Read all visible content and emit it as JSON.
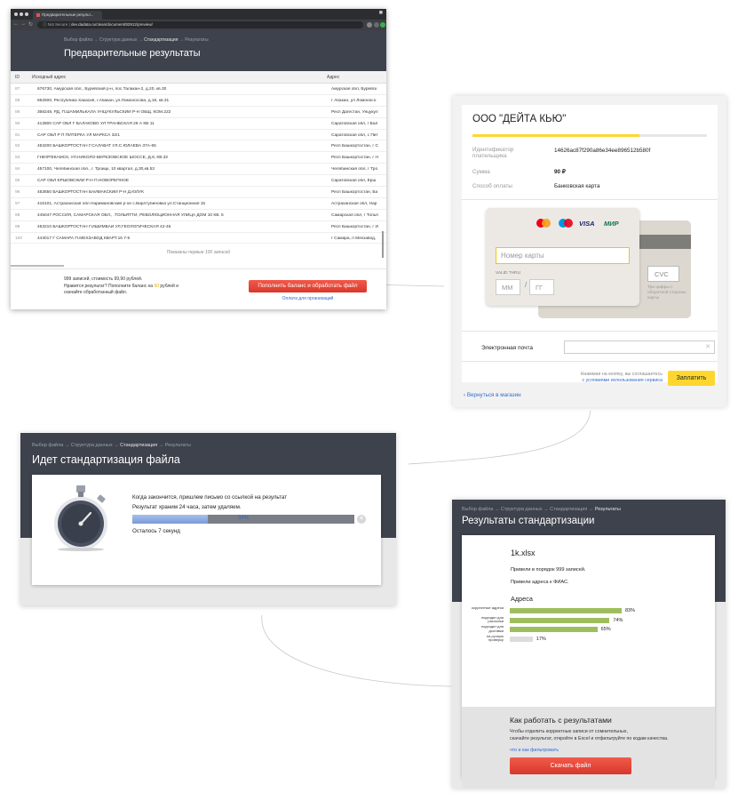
{
  "browser": {
    "tab_title": "Предварительные результ...",
    "url_secure": "Not Secure",
    "url_text": "dev.dadata.ru/clean/document/82912/preview/",
    "breadcrumbs": [
      "Выбор файла",
      "Структура данных",
      "Стандартизация",
      "Результаты"
    ],
    "breadcrumb_current": "Стандартизация",
    "title": "Предварительные результаты",
    "columns": {
      "id": "ID",
      "source": "Исходный адрес",
      "address": "Адрес"
    },
    "rows": [
      {
        "id": "87",
        "source": "676730, Амурская обл., Бурейский р-н, пос.Талакан-2, д.20, кв.30",
        "address": "Амурская обл, Бурейск"
      },
      {
        "id": "88",
        "source": "662600, Республика Хакасия, г.Абакан, ул.Ломоносова, д.16, кв.31",
        "address": "г Абакан, ул Ломоносо"
      },
      {
        "id": "89",
        "source": "368248, РД, П.ШАМИЛЬКАЛА УНЦУКУЛЬСКИЙ Р-Н ОБЩ. КОМ.222",
        "address": "Респ Дагестан, Унцукул"
      },
      {
        "id": "90",
        "source": "413800 САР ОБЛ Г БАЛАКОВО УЛ ТРАНБСКАЯ 28 А КВ 11",
        "address": "Саратовская обл, г Бал"
      },
      {
        "id": "91",
        "source": "САР ОБЛ Р П ПИТЕРКА УЛ МАРКСА 32/1",
        "address": "Саратовская обл, с Пит"
      },
      {
        "id": "92",
        "source": "453200 БАШКОРТОСТАН Г.САЛАВАТ УЛ.С.ЮЛАЕВА 37А-65",
        "address": "Респ Башкортостан, г С"
      },
      {
        "id": "93",
        "source": "ГНЕФТЕКАМСК, УЛ.НИКОЛО-БЕРЕЗОВСКОЕ ШОССЕ, Д.8, КВ.32",
        "address": "Респ Башкортостан, г Н"
      },
      {
        "id": "94",
        "source": "457100, Челябинская обл., г. Троицк, 10 квартал, д.30,кв.53",
        "address": "Челябинская обл, г Тро"
      },
      {
        "id": "95",
        "source": "САР ОБЛ ЕРШОВСКИЙ Р-Н П.НОВОРЕПНОЕ",
        "address": "Саратовская обл, Ерш"
      },
      {
        "id": "96",
        "source": "453650 БАШКОРТОСТАН БАЙМАКСКИЙ Р-Н Д.ЮЛУК",
        "address": "Респ Башкортостан, Ба"
      },
      {
        "id": "97",
        "source": "416101, Астраханская обл Наримановский р-он с.Бирлтубиновка ул.Станционная 15",
        "address": "Астраханская обл, Нар"
      },
      {
        "id": "98",
        "source": "445047 РОССИЯ, САМАРСКАЯ ОБЛ., .ТОЛЬЯТТИ, РЕВОЛЮЦИОННАЯ УЛИЦА ДОМ 10 КВ. 5",
        "address": "Самарская обл, г Толья"
      },
      {
        "id": "99",
        "source": "453210 БАШКОРТОСТАН Г.ИШИМБАЙ УЛ.ГЕОЛОГИЧЕСКАЯ 42-45",
        "address": "Респ Башкортостан, г И"
      },
      {
        "id": "100",
        "source": "443017 Г САМАРА П.МЕХЗАВОД КВАРТ.16 7-5",
        "address": "г Самара, п Мехзавод,"
      }
    ],
    "shown_note": "Показаны первые 100 записей",
    "summary_line1": "999 записей, стоимость 99,90 рублей.",
    "summary_line2_a": "Нравится результат? Пополните баланс на ",
    "summary_amount": "90",
    "summary_line2_b": " рублей и",
    "summary_line3": "скачайте обработанный файл.",
    "button": "Пополнить баланс и обработать файл",
    "org_link": "Оплата для организаций"
  },
  "payment": {
    "org": "ООО \"ДЕЙТА КЬЮ\"",
    "payer_id_label": "Идентификатор плательщика",
    "payer_id": "14626ac87f290a86e34ee896512b580f",
    "sum_label": "Сумма",
    "sum": "90 ₽",
    "method_label": "Способ оплаты",
    "method": "Банковская карта",
    "brand_visa": "VISA",
    "brand_mir": "МИР",
    "card_number_placeholder": "Номер карты",
    "valid_thru": "VALID THRU",
    "mm": "ММ",
    "yy": "ГГ",
    "cvc": "CVC",
    "cvc_hint": "Три цифры с оборотной стороны карты",
    "email_label": "Электронная почта",
    "agree_text": "Нажимая на кнопку, вы соглашаетесь",
    "agree_link": "с условиями использования сервиса",
    "pay_button": "Заплатить",
    "back_link": "Вернуться в магазин",
    "colors": {
      "stripe_gray": "#e0e0e0",
      "stripe_yellow": "#fdd730",
      "pay": "#fdd730"
    }
  },
  "progress": {
    "breadcrumbs": [
      "Выбор файла",
      "Структура данных",
      "Стандартизация",
      "Результаты"
    ],
    "breadcrumb_current": "Стандартизация",
    "title": "Идет стандартизация файла",
    "msg1": "Когда закончится, пришлем письмо со ссылкой на результат",
    "msg2": "Результат храним 24 часа, затем удаляем.",
    "percent": 34,
    "percent_label": "34%",
    "remaining": "Осталось 7 секунд"
  },
  "results": {
    "breadcrumbs": [
      "Выбор файла",
      "Структура данных",
      "Стандартизация",
      "Результаты"
    ],
    "breadcrumb_current": "Результаты",
    "title": "Результаты стандартизации",
    "file": "1k.xlsx",
    "info1": "Привели в порядок 999 записей.",
    "info2": "Привели адреса к ФИАС.",
    "section": "Адреса",
    "bars": [
      {
        "label": "корректные адреса",
        "value": 83,
        "value_label": "83%"
      },
      {
        "label": "подходят для рассылки",
        "value": 74,
        "value_label": "74%"
      },
      {
        "label": "подходят для доставки",
        "value": 65,
        "value_label": "65%"
      },
      {
        "label": "на ручную проверку",
        "value": 17,
        "value_label": "17%"
      }
    ],
    "how_title": "Как работать с результатами",
    "how_text1": "Чтобы отделить корректные записи от сомнительных,",
    "how_text2": "скачайте результат, откройте в Excel и отфильтруйте по кодам качества.",
    "how_link": "что и как фильтровать",
    "download": "Скачать файл"
  }
}
